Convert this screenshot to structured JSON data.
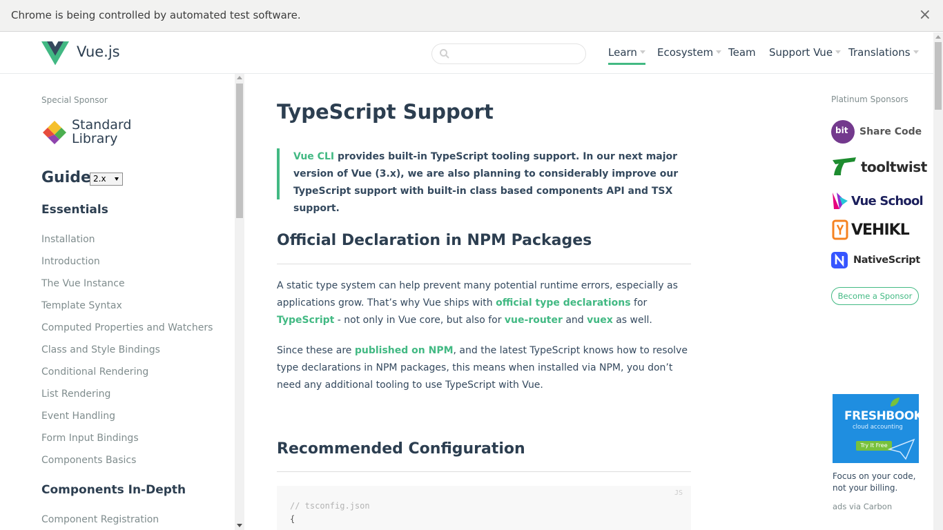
{
  "infobar": {
    "message": "Chrome is being controlled by automated test software.",
    "close_symbol": "×"
  },
  "header": {
    "brand": "Vue.js",
    "search": {
      "value": "",
      "placeholder": ""
    },
    "nav": [
      {
        "label": "Learn",
        "dropdown": true,
        "active": true
      },
      {
        "label": "Ecosystem",
        "dropdown": true
      },
      {
        "label": "Team",
        "dropdown": false
      },
      {
        "label": "Support Vue",
        "dropdown": true
      },
      {
        "label": "Translations",
        "dropdown": true
      }
    ],
    "icons": [
      "vue-logo-icon",
      "search-icon"
    ]
  },
  "sidebar": {
    "special_sponsor_label": "Special Sponsor",
    "special_sponsor": {
      "line1": "Standard",
      "line2": "Library"
    },
    "guide_title": "Guide",
    "version": "2.x",
    "sections": [
      {
        "title": "Essentials",
        "items": [
          "Installation",
          "Introduction",
          "The Vue Instance",
          "Template Syntax",
          "Computed Properties and Watchers",
          "Class and Style Bindings",
          "Conditional Rendering",
          "List Rendering",
          "Event Handling",
          "Form Input Bindings",
          "Components Basics"
        ]
      },
      {
        "title": "Components In-Depth",
        "items": [
          "Component Registration"
        ]
      }
    ]
  },
  "main": {
    "title": "TypeScript Support",
    "tip": {
      "link": "Vue CLI",
      "text": " provides built-in TypeScript tooling support. In our next major version of Vue (3.x), we are also planning to considerably improve our TypeScript support with built-in class based components API and TSX support."
    },
    "section1": {
      "heading": "Official Declaration in NPM Packages",
      "p1": {
        "t1": "A static type system can help prevent many potential runtime errors, especially as applications grow. That’s why Vue ships with ",
        "l1": "official type declarations",
        "t2": " for ",
        "l2": "TypeScript",
        "t3": " - not only in Vue core, but also for ",
        "l3": "vue-router",
        "t4": " and ",
        "l4": "vuex",
        "t5": " as well."
      },
      "p2": {
        "t1": "Since these are ",
        "l1": "published on NPM",
        "t2": ", and the latest TypeScript knows how to resolve type declarations in NPM packages, this means when installed via NPM, you don’t need any additional tooling to use TypeScript with Vue."
      }
    },
    "section2": {
      "heading": "Recommended Configuration",
      "code_lang": "JS",
      "code_lines": [
        "// tsconfig.json",
        "{"
      ]
    }
  },
  "right": {
    "platinum_label": "Platinum Sponsors",
    "sponsors": [
      {
        "name": "Share Code",
        "badge": "bit",
        "color": "#73398d"
      },
      {
        "name": "tooltwist",
        "color": "#2c2c2c"
      },
      {
        "name": "Vue School",
        "color": "#1b1f5c"
      },
      {
        "name": "VEHIKL",
        "color": "#1a1a1a"
      },
      {
        "name": "NativeScript",
        "color": "#2c2c2c"
      }
    ],
    "become_sponsor": "Become a Sponsor",
    "ad": {
      "brand": "FRESHBOOKS",
      "brand_sub": "cloud accounting",
      "cta": "Try It Free",
      "text": "Focus on your code, not your billing.",
      "via": "ads via Carbon"
    }
  },
  "colors": {
    "accent": "#42b983",
    "heading": "#2c3e50",
    "text": "#34495e",
    "muted": "#7f8c8d"
  }
}
